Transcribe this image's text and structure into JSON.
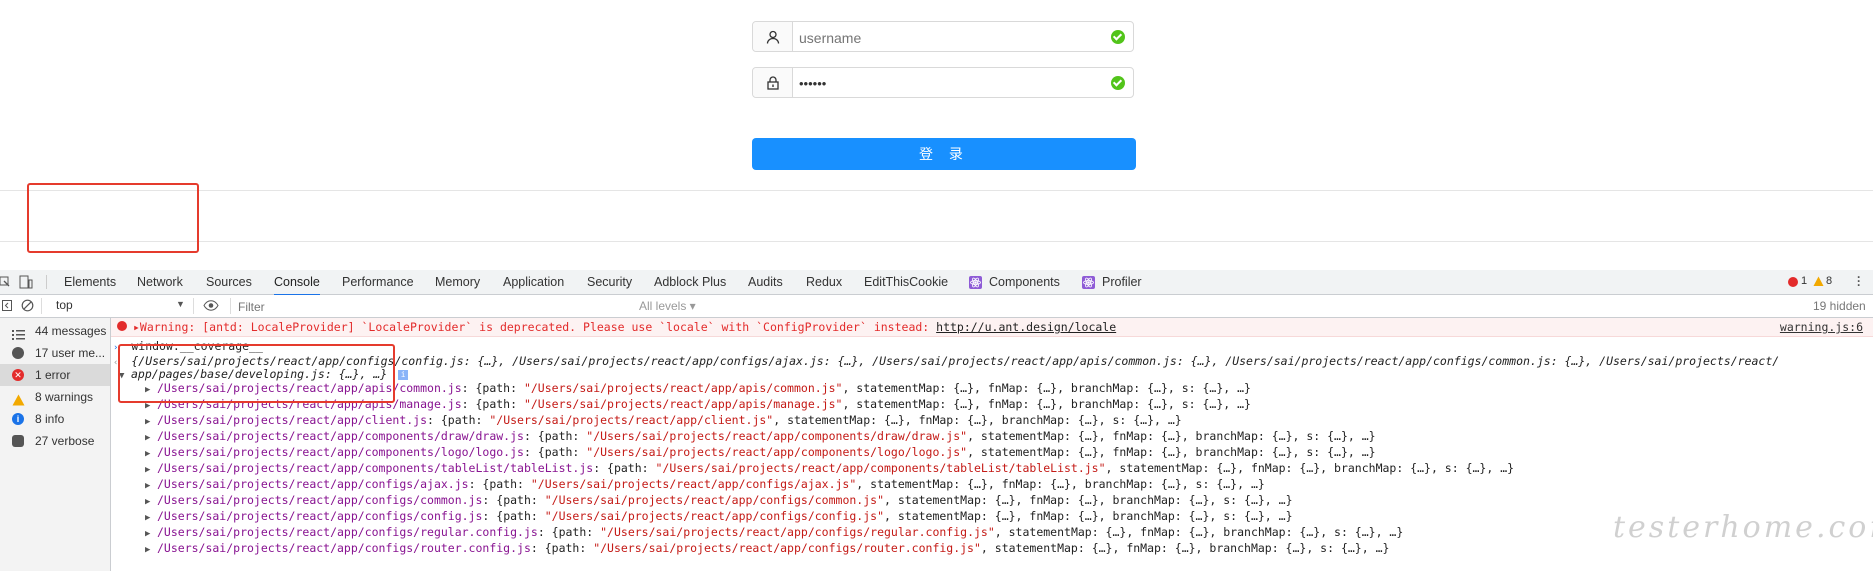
{
  "login": {
    "username_placeholder": "username",
    "password_value": "••••••",
    "submit_label": "登 录"
  },
  "devtools": {
    "tabs": [
      "Elements",
      "Network",
      "Sources",
      "Console",
      "Performance",
      "Memory",
      "Application",
      "Security",
      "Adblock Plus",
      "Audits",
      "Redux",
      "EditThisCookie",
      "Components",
      "Profiler"
    ],
    "active_tab": "Console",
    "error_count": "1",
    "warning_count": "8",
    "context": "top",
    "filter_placeholder": "Filter",
    "levels": "All levels ▾",
    "hidden": "19 hidden",
    "sidebar": [
      {
        "label": "44 messages",
        "icon": "list-icon"
      },
      {
        "label": "17 user me...",
        "icon": "user-icon"
      },
      {
        "label": "1 error",
        "icon": "error-icon"
      },
      {
        "label": "8 warnings",
        "icon": "warning-icon"
      },
      {
        "label": "8 info",
        "icon": "info-icon"
      },
      {
        "label": "27 verbose",
        "icon": "bug-icon"
      }
    ],
    "warning_text": "▸Warning: [antd: LocaleProvider] `LocaleProvider` is deprecated. Please use `locale` with `ConfigProvider` instead: ",
    "warning_link": "http://u.ant.design/locale",
    "warning_source": "warning.js:6",
    "command": "window.__coverage__",
    "summary_line1": "{/Users/sai/projects/react/app/configs/config.js: {…}, /Users/sai/projects/react/app/configs/ajax.js: {…}, /Users/sai/projects/react/app/apis/common.js: {…}, /Users/sai/projects/react/app/configs/common.js: {…}, /Users/sai/projects/react/",
    "summary_line2": "app/pages/base/developing.js: {…}, …}",
    "entries": [
      {
        "key": "/Users/sai/projects/react/app/apis/common.js",
        "path": "\"/Users/sai/projects/react/app/apis/common.js\"",
        "rest": ", statementMap: {…}, fnMap: {…}, branchMap: {…}, s: {…}, …}"
      },
      {
        "key": "/Users/sai/projects/react/app/apis/manage.js",
        "path": "\"/Users/sai/projects/react/app/apis/manage.js\"",
        "rest": ", statementMap: {…}, fnMap: {…}, branchMap: {…}, s: {…}, …}"
      },
      {
        "key": "/Users/sai/projects/react/app/client.js",
        "path": "\"/Users/sai/projects/react/app/client.js\"",
        "rest": ", statementMap: {…}, fnMap: {…}, branchMap: {…}, s: {…}, …}"
      },
      {
        "key": "/Users/sai/projects/react/app/components/draw/draw.js",
        "path": "\"/Users/sai/projects/react/app/components/draw/draw.js\"",
        "rest": ", statementMap: {…}, fnMap: {…}, branchMap: {…}, s: {…}, …}"
      },
      {
        "key": "/Users/sai/projects/react/app/components/logo/logo.js",
        "path": "\"/Users/sai/projects/react/app/components/logo/logo.js\"",
        "rest": ", statementMap: {…}, fnMap: {…}, branchMap: {…}, s: {…}, …}"
      },
      {
        "key": "/Users/sai/projects/react/app/components/tableList/tableList.js",
        "path": "\"/Users/sai/projects/react/app/components/tableList/tableList.js\"",
        "rest": ", statementMap: {…}, fnMap: {…}, branchMap: {…}, s: {…}, …}"
      },
      {
        "key": "/Users/sai/projects/react/app/configs/ajax.js",
        "path": "\"/Users/sai/projects/react/app/configs/ajax.js\"",
        "rest": ", statementMap: {…}, fnMap: {…}, branchMap: {…}, s: {…}, …}"
      },
      {
        "key": "/Users/sai/projects/react/app/configs/common.js",
        "path": "\"/Users/sai/projects/react/app/configs/common.js\"",
        "rest": ", statementMap: {…}, fnMap: {…}, branchMap: {…}, s: {…}, …}"
      },
      {
        "key": "/Users/sai/projects/react/app/configs/config.js",
        "path": "\"/Users/sai/projects/react/app/configs/config.js\"",
        "rest": ", statementMap: {…}, fnMap: {…}, branchMap: {…}, s: {…}, …}"
      },
      {
        "key": "/Users/sai/projects/react/app/configs/regular.config.js",
        "path": "\"/Users/sai/projects/react/app/configs/regular.config.js\"",
        "rest": ", statementMap: {…}, fnMap: {…}, branchMap: {…}, s: {…}, …}"
      },
      {
        "key": "/Users/sai/projects/react/app/configs/router.config.js",
        "path": "\"/Users/sai/projects/react/app/configs/router.config.js\"",
        "rest": ", statementMap: {…}, fnMap: {…}, branchMap: {…}, s: {…}, …}"
      }
    ]
  },
  "watermark": "testerhome.com",
  "colors": {
    "accent": "#1890ff",
    "success": "#52c41a",
    "error": "#e32b2b",
    "highlight": "#e53b2d"
  }
}
